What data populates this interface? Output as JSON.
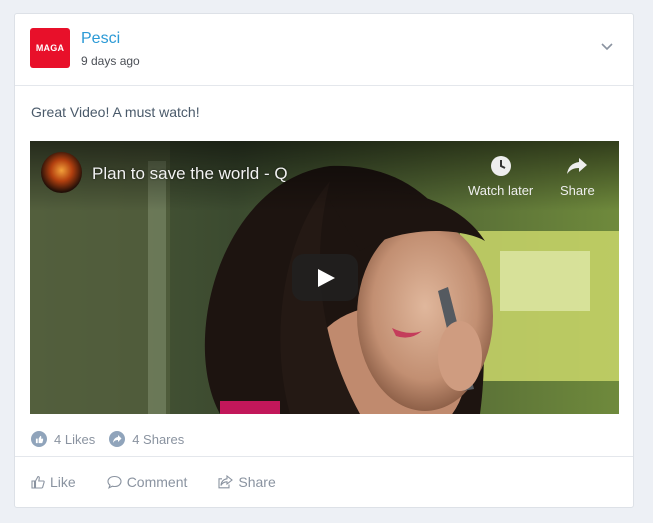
{
  "post": {
    "avatar_text": "MAGA",
    "author": "Pesci",
    "time": "9 days ago",
    "text": "Great Video! A must watch!"
  },
  "video": {
    "title": "Plan to save the world - Q",
    "watch_later": "Watch later",
    "share": "Share"
  },
  "stats": {
    "likes": "4 Likes",
    "shares": "4 Shares"
  },
  "actions": {
    "like": "Like",
    "comment": "Comment",
    "share": "Share"
  },
  "colors": {
    "accent": "#2b9ad6",
    "avatar_bg": "#e8102a",
    "muted": "#8a93a0"
  }
}
